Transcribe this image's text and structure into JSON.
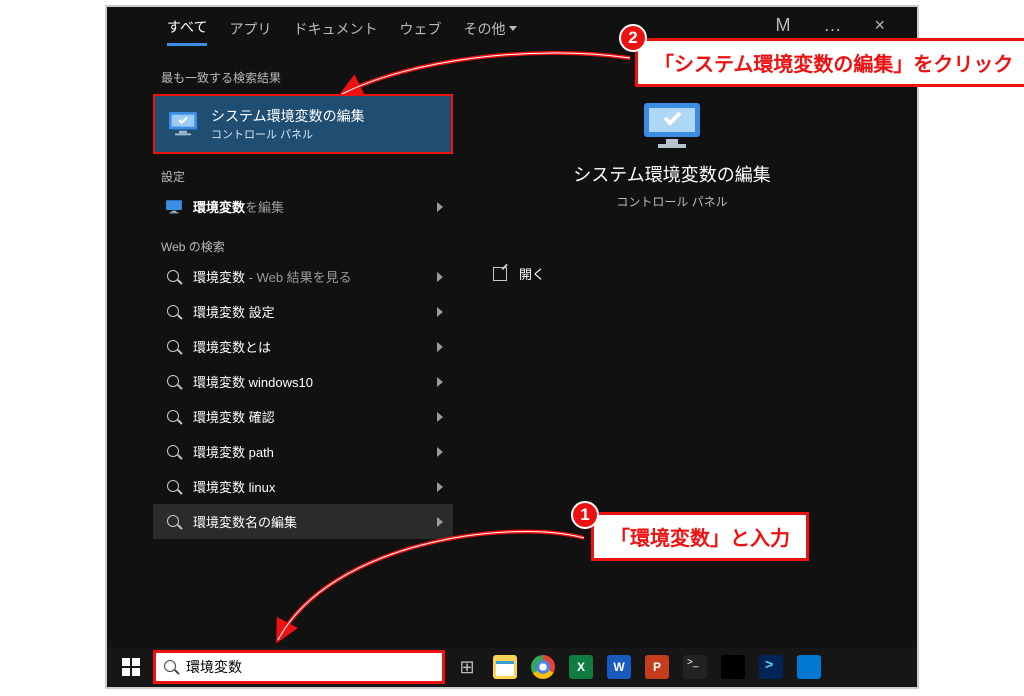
{
  "tabs": {
    "all": "すべて",
    "apps": "アプリ",
    "documents": "ドキュメント",
    "web": "ウェブ",
    "more": "その他"
  },
  "section_best": "最も一致する検索結果",
  "best": {
    "title": "システム環境変数の編集",
    "subtitle": "コントロール パネル"
  },
  "group_settings": "設定",
  "settings_item": {
    "label": "環境変数",
    "extra": "を編集"
  },
  "group_web": "Web の検索",
  "web_items": [
    {
      "label": "環境変数",
      "extra": " - Web 結果を見る"
    },
    {
      "label": "環境変数 設定",
      "extra": ""
    },
    {
      "label": "環境変数とは",
      "extra": ""
    },
    {
      "label": "環境変数 windows10",
      "extra": ""
    },
    {
      "label": "環境変数 確認",
      "extra": ""
    },
    {
      "label": "環境変数 path",
      "extra": ""
    },
    {
      "label": "環境変数 linux",
      "extra": ""
    },
    {
      "label": "環境変数名の編集",
      "extra": ""
    }
  ],
  "preview": {
    "title": "システム環境変数の編集",
    "subtitle": "コントロール パネル",
    "open": "開く"
  },
  "search_value": "環境変数",
  "callout1": "「環境変数」と入力",
  "callout2": "「システム環境変数の編集」をクリック"
}
